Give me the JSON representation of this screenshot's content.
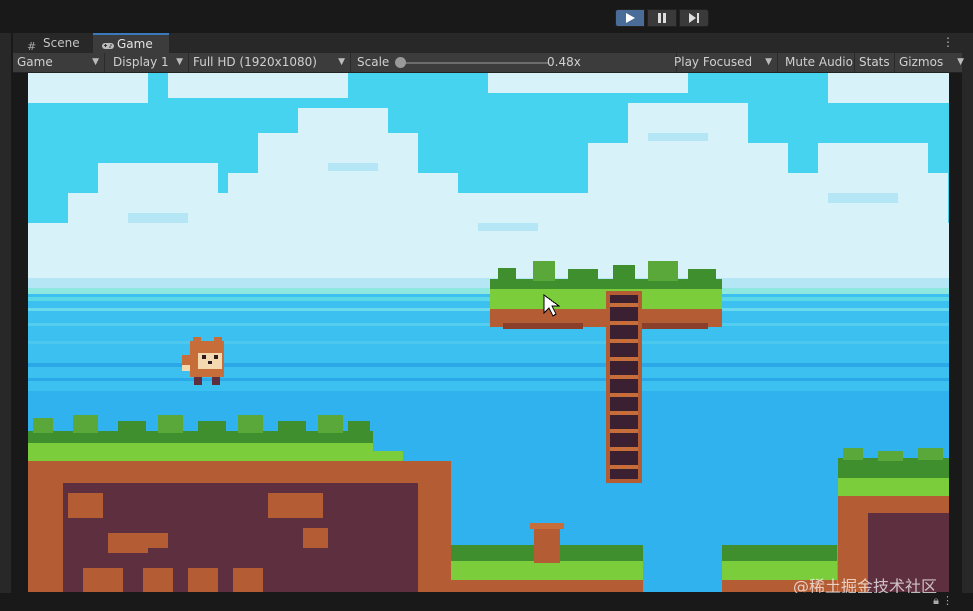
{
  "playbar": {
    "play_icon": "play-icon",
    "pause_icon": "pause-icon",
    "step_icon": "step-icon",
    "play_active": true,
    "accent": "#4a6c98"
  },
  "tabs": [
    {
      "label": "Scene",
      "icon": "hash-icon"
    },
    {
      "label": "Game",
      "icon": "gamepad-icon",
      "active": true
    }
  ],
  "toolbar": {
    "game_view_select": "Game",
    "display_select": "Display 1",
    "resolution_select": "Full HD (1920x1080)",
    "scale_label": "Scale",
    "scale_value": "0.48x",
    "play_mode_select": "Play Focused",
    "mute_audio": "Mute Audio",
    "stats": "Stats",
    "gizmos": "Gizmos"
  },
  "game": {
    "sky_color": "#45d3f0",
    "water_color": "#3cc0f0",
    "cloud_color": "#d7f2f9",
    "grass_color": "#7ccd3c",
    "dirt_color": "#b45c34",
    "dark_dirt_color": "#5e2f3e"
  },
  "watermark": "@稀土掘金技术社区"
}
